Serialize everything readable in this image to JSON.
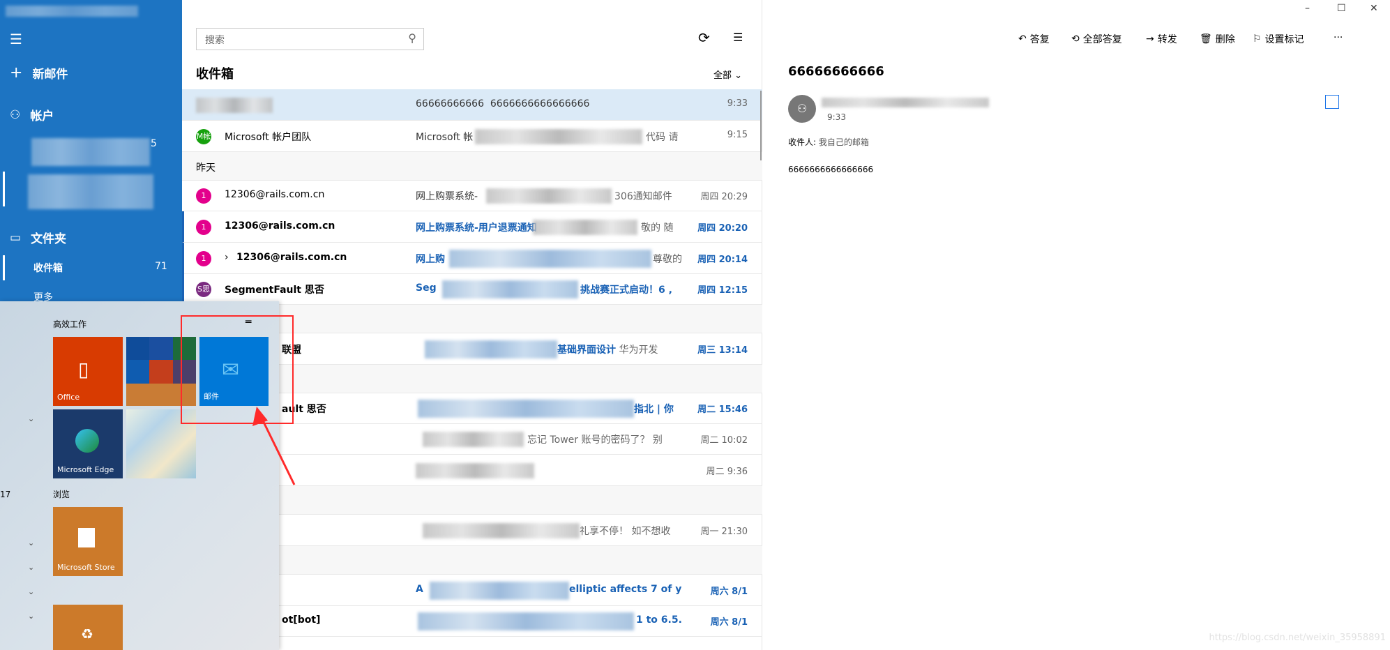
{
  "sidebar": {
    "new_mail": "新邮件",
    "accounts": "帐户",
    "account_count": "5",
    "folders": "文件夹",
    "inbox": "收件箱",
    "inbox_count": "71",
    "more": "更多"
  },
  "list": {
    "search_placeholder": "搜索",
    "title": "收件箱",
    "filter": "全部",
    "rows": [
      {
        "sender": "",
        "subject": "66666666666",
        "preview": "6666666666666666",
        "time": "9:33"
      },
      {
        "avatar": "M帐",
        "sender": "Microsoft 帐户团队",
        "subject": "Microsoft 帐",
        "preview": "代码 请",
        "time": "9:15"
      },
      {
        "avatar": "1",
        "sender": "12306@rails.com.cn",
        "subject": "网上购票系统-",
        "preview": "306通知邮件",
        "time": "周四 20:29"
      },
      {
        "avatar": "1",
        "sender": "12306@rails.com.cn",
        "subject": "网上购票系统-用户退票通知",
        "preview": "敬的 随",
        "time": "周四 20:20"
      },
      {
        "avatar": "1",
        "sender": "12306@rails.com.cn",
        "subject": "网上购",
        "preview": "尊敬的",
        "time": "周四 20:14"
      },
      {
        "avatar": "S思",
        "sender": "SegmentFault 思否",
        "subject": "Seg",
        "preview": "挑战赛正式启动！6 ,",
        "time": "周四 12:15"
      },
      {
        "sender": "联盟",
        "subject": "基础界面设计",
        "preview": "华为开发",
        "time": "周三 13:14"
      },
      {
        "sender": "ault 思否",
        "subject": "指北 | 你",
        "preview": "",
        "time": "周二 15:46"
      },
      {
        "sender": "",
        "subject": "",
        "preview": "忘记 Tower 账号的密码了？ 别",
        "time": "周二 10:02"
      },
      {
        "sender": "",
        "subject": "",
        "preview": "",
        "time": "周二 9:36"
      },
      {
        "sender": "",
        "subject": "",
        "preview": "礼享不停！ 如不想收",
        "time": "周一 21:30"
      },
      {
        "sender": "",
        "subject": "A",
        "preview": "elliptic affects 7 of y",
        "time": "周六 8/1"
      },
      {
        "sender": "ot[bot]",
        "subject": "1 to 6.5.",
        "preview": "",
        "time": "周六 8/1"
      }
    ],
    "group_yesterday": "昨天"
  },
  "reader": {
    "toolbar": {
      "reply": "答复",
      "reply_all": "全部答复",
      "forward": "转发",
      "delete": "删除",
      "flag": "设置标记",
      "more": "···"
    },
    "subject": "66666666666",
    "time": "9:33",
    "to_label": "收件人:",
    "to_value": "我自己的邮箱",
    "body": "6666666666666666"
  },
  "start_menu": {
    "group1": "高效工作",
    "group2": "浏览",
    "office": "Office",
    "mail": "邮件",
    "edge": "Microsoft Edge",
    "store": "Microsoft Store",
    "side_number": "17"
  },
  "watermark": "https://blog.csdn.net/weixin_35958891",
  "colors": {
    "sidebar": "#1d74c2",
    "accent": "#1a62b5",
    "selected_row": "#dbeaf7",
    "annotation": "#ff2a2a"
  }
}
